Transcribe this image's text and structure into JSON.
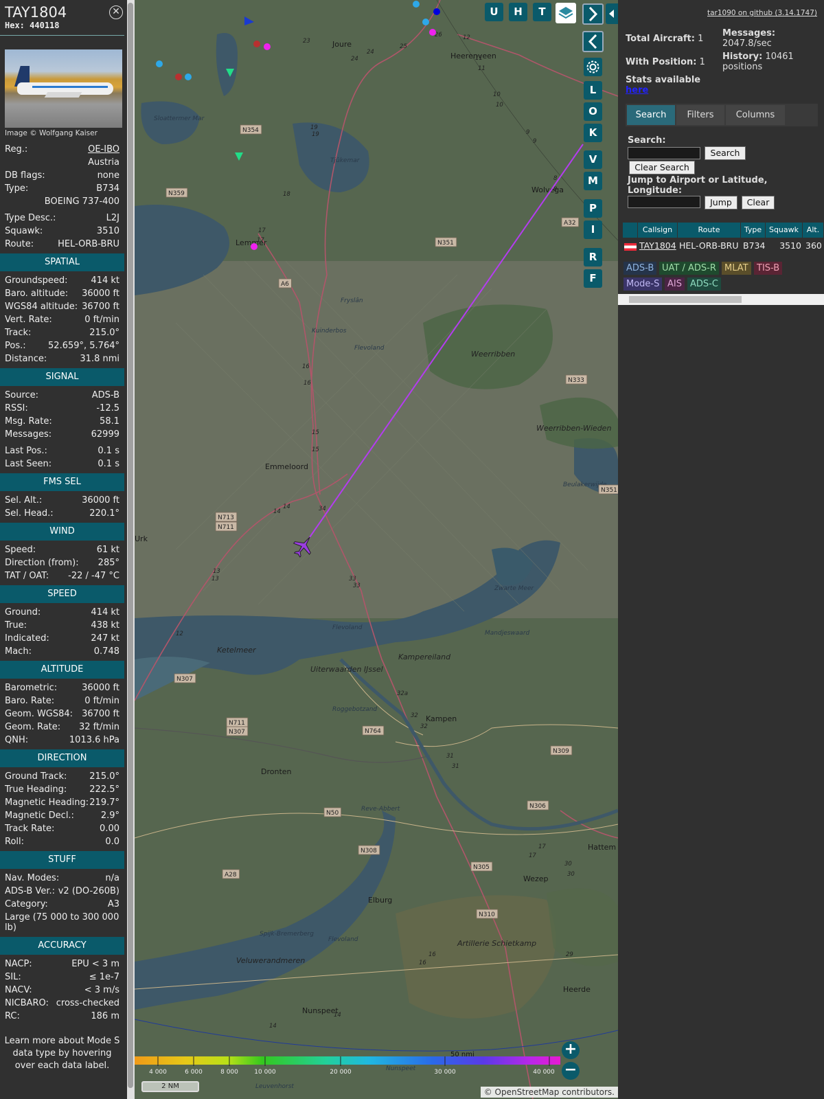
{
  "info": {
    "callsign": "TAY1804",
    "hex_label": "Hex:",
    "hex": "440118",
    "photo_credit": "Image © Wolfgang Kaiser",
    "basic": [
      {
        "label": "Reg.:",
        "value": "OE-IBO",
        "link": true
      },
      {
        "label": "",
        "value": "Austria"
      },
      {
        "label": "DB flags:",
        "value": "none"
      },
      {
        "label": "Type:",
        "value": "B734"
      },
      {
        "label": "",
        "value": "BOEING 737-400"
      },
      {
        "label": "Type Desc.:",
        "value": "L2J"
      },
      {
        "label": "Squawk:",
        "value": "3510"
      },
      {
        "label": "Route:",
        "value": "HEL-ORB-BRU"
      }
    ],
    "sections": [
      {
        "title": "SPATIAL",
        "rows": [
          {
            "label": "Groundspeed:",
            "value": "414 kt"
          },
          {
            "label": "Baro. altitude:",
            "value": "36000 ft"
          },
          {
            "label": "WGS84 altitude:",
            "value": "36700 ft"
          },
          {
            "label": "Vert. Rate:",
            "value": "0 ft/min"
          },
          {
            "label": "Track:",
            "value": "215.0°"
          },
          {
            "label": "Pos.:",
            "value": "52.659°, 5.764°"
          },
          {
            "label": "Distance:",
            "value": "31.8 nmi"
          }
        ]
      },
      {
        "title": "SIGNAL",
        "rows": [
          {
            "label": "Source:",
            "value": "ADS-B"
          },
          {
            "label": "RSSI:",
            "value": "-12.5"
          },
          {
            "label": "Msg. Rate:",
            "value": "58.1"
          },
          {
            "label": "Messages:",
            "value": "62999"
          },
          {
            "label": "Last Pos.:",
            "value": "0.1 s"
          },
          {
            "label": "Last Seen:",
            "value": "0.1 s"
          }
        ]
      },
      {
        "title": "FMS SEL",
        "rows": [
          {
            "label": "Sel. Alt.:",
            "value": "36000 ft"
          },
          {
            "label": "Sel. Head.:",
            "value": "220.1°"
          }
        ]
      },
      {
        "title": "WIND",
        "rows": [
          {
            "label": "Speed:",
            "value": "61 kt"
          },
          {
            "label": "Direction (from):",
            "value": "285°"
          },
          {
            "label": "TAT / OAT:",
            "value": "-22 / -47 °C"
          }
        ]
      },
      {
        "title": "SPEED",
        "rows": [
          {
            "label": "Ground:",
            "value": "414 kt"
          },
          {
            "label": "True:",
            "value": "438 kt"
          },
          {
            "label": "Indicated:",
            "value": "247 kt"
          },
          {
            "label": "Mach:",
            "value": "0.748"
          }
        ]
      },
      {
        "title": "ALTITUDE",
        "rows": [
          {
            "label": "Barometric:",
            "value": "36000 ft"
          },
          {
            "label": "Baro. Rate:",
            "value": "0 ft/min"
          },
          {
            "label": "Geom. WGS84:",
            "value": "36700 ft"
          },
          {
            "label": "Geom. Rate:",
            "value": "32 ft/min"
          },
          {
            "label": "QNH:",
            "value": "1013.6 hPa"
          }
        ]
      },
      {
        "title": "DIRECTION",
        "rows": [
          {
            "label": "Ground Track:",
            "value": "215.0°"
          },
          {
            "label": "True Heading:",
            "value": "222.5°"
          },
          {
            "label": "Magnetic Heading:",
            "value": "219.7°"
          },
          {
            "label": "Magnetic Decl.:",
            "value": "2.9°"
          },
          {
            "label": "Track Rate:",
            "value": "0.00"
          },
          {
            "label": "Roll:",
            "value": "0.0"
          }
        ]
      },
      {
        "title": "STUFF",
        "rows": [
          {
            "label": "Nav. Modes:",
            "value": "n/a"
          },
          {
            "label": "ADS-B Ver.:",
            "value": "v2 (DO-260B)"
          },
          {
            "label": "Category:",
            "value": "A3"
          },
          {
            "label": "Large (75 000 to 300 000 lb)",
            "value": "",
            "tall": true
          }
        ]
      },
      {
        "title": "ACCURACY",
        "rows": [
          {
            "label": "NACP:",
            "value": "EPU < 3 m"
          },
          {
            "label": "SIL:",
            "value": "≤ 1e-7"
          },
          {
            "label": "NACV:",
            "value": "< 3 m/s"
          },
          {
            "label": "NICBARO:",
            "value": "cross-checked"
          },
          {
            "label": "RC:",
            "value": "186 m"
          }
        ]
      }
    ],
    "footer_note": "Learn more about Mode S data type by hovering over each data label."
  },
  "map": {
    "top_buttons": [
      "U",
      "H",
      "T"
    ],
    "side_buttons": [
      "L",
      "O",
      "K",
      "V",
      "M",
      "P",
      "I",
      "R",
      "F"
    ],
    "places": {
      "joure": "Joure",
      "heerenveen": "Heerenveen",
      "sloten": "Sloattermer Mar",
      "tjeuke": "Tjûkemar",
      "wolvega": "Wolvega",
      "lemmer": "Lemmer",
      "fryslan": "Fryslân",
      "kuinderbos": "Kuinderbos",
      "flevoland1": "Flevoland",
      "weerribben": "Weerribben",
      "weerribben_wieden": "Weerribben-Wieden",
      "beulaker": "Beulakerwijde",
      "emmeloord": "Emmeloord",
      "urk": "Urk",
      "zwarte_meer": "Zwarte Meer",
      "flevoland2": "Flevoland",
      "mandjeswaard": "Mandjeswaard",
      "ketelmeer": "Ketelmeer",
      "uiterwaarden": "Uiterwaarden IJssel",
      "kampereiland": "Kampereiland",
      "roggebotzand": "Roggebotzand",
      "kampen": "Kampen",
      "dronten": "Dronten",
      "reve_abbert": "Reve-Abbert",
      "hattem": "Hattem",
      "wezep": "Wezep",
      "elburg": "Elburg",
      "artillerie": "Artillerie Schietkamp",
      "spijk": "Spijk-Bremerberg",
      "flevoland3": "Flevoland",
      "veluwerandmeren": "Veluwerandmeren",
      "heerde": "Heerde",
      "nunspeet": "Nunspeet",
      "nunspeet2": "Nunspeet",
      "leuvenhorst": "Leuvenhorst"
    },
    "road_labels": [
      "N354",
      "N359",
      "A6",
      "N351",
      "A32",
      "N333",
      "N351",
      "N713",
      "N711",
      "N307",
      "N711",
      "N307",
      "N764",
      "N309",
      "N50",
      "N306",
      "N308",
      "N305",
      "A28",
      "N310"
    ],
    "altitude_legend": [
      "4 000",
      "6 000",
      "8 000",
      "10 000",
      "20 000",
      "30 000",
      "40 000"
    ],
    "scale_top": "50 nmi",
    "scale_bottom": "2 NM",
    "attribution": "© OpenStreetMap contributors."
  },
  "sidebar": {
    "github": "tar1090 on github (3.14.1747)",
    "total_aircraft_label": "Total Aircraft:",
    "total_aircraft": "1",
    "with_position_label": "With Position:",
    "with_position": "1",
    "messages_label": "Messages:",
    "messages": "2047.8/sec",
    "history_label": "History:",
    "history": "10461 positions",
    "stats_note": "Stats available",
    "stats_link": "here",
    "tabs": [
      "Search",
      "Filters",
      "Columns"
    ],
    "search_label": "Search:",
    "search_button": "Search",
    "clear_search_button": "Clear Search",
    "jump_label": "Jump to Airport or Latitude, Longitude:",
    "jump_button": "Jump",
    "clear_button": "Clear",
    "table": {
      "headers": [
        "Callsign",
        "Route",
        "Type",
        "Squawk",
        "Alt."
      ],
      "row": {
        "callsign": "TAY1804",
        "route": "HEL-ORB-BRU",
        "type": "B734",
        "squawk": "3510",
        "alt": "360"
      }
    },
    "sources": [
      {
        "label": "ADS-B",
        "color": "#25344a",
        "text": "#8fb3e0"
      },
      {
        "label": "UAT / ADS-R",
        "color": "#1f4a2e",
        "text": "#9fdca8"
      },
      {
        "label": "MLAT",
        "color": "#5a4e2a",
        "text": "#e6cf8a"
      },
      {
        "label": "TIS-B",
        "color": "#5a2434",
        "text": "#f0a0b4"
      },
      {
        "label": "Mode-S",
        "color": "#3a3468",
        "text": "#c0b8f4"
      },
      {
        "label": "AIS",
        "color": "#4a2444",
        "text": "#e0a8d8"
      },
      {
        "label": "ADS-C",
        "color": "#1e4a3e",
        "text": "#8fdcc0"
      }
    ]
  }
}
